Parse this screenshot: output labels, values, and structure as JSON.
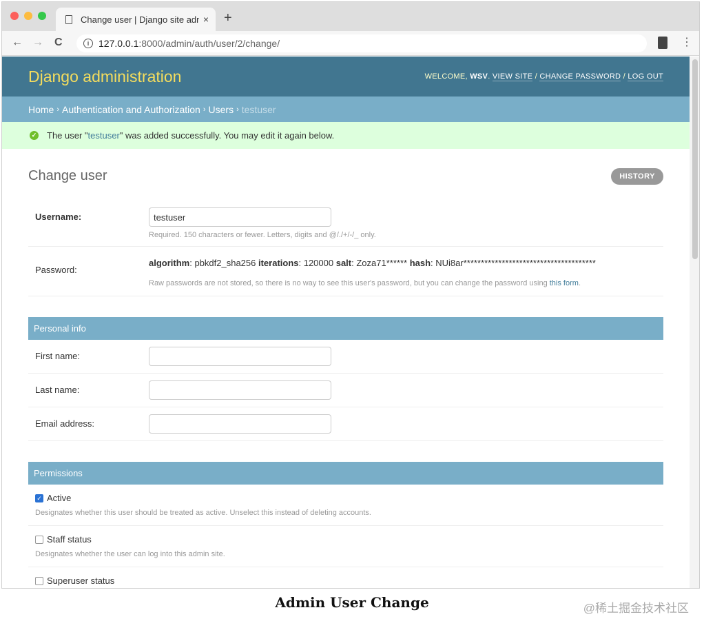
{
  "browser": {
    "tab_title": "Change user | Django site adm",
    "tab_close": "×",
    "new_tab": "+",
    "url_host": "127.0.0.1",
    "url_path": ":8000/admin/auth/user/2/change/",
    "back": "←",
    "forward": "→",
    "reload": "C",
    "menu": "⋮",
    "info": "i"
  },
  "header": {
    "branding": "Django administration",
    "welcome": "WELCOME, ",
    "username": "WSV",
    "view_site": "VIEW SITE",
    "change_password": "CHANGE PASSWORD",
    "log_out": "LOG OUT",
    "sep": " / "
  },
  "breadcrumbs": {
    "home": "Home",
    "app": "Authentication and Authorization",
    "model": "Users",
    "current": "testuser",
    "sep": "›"
  },
  "message": {
    "pre": "The user \"",
    "link": "testuser",
    "post": "\" was added successfully. You may edit it again below."
  },
  "page": {
    "title": "Change user",
    "history": "HISTORY"
  },
  "form": {
    "username": {
      "label": "Username:",
      "value": "testuser",
      "help": "Required. 150 characters or fewer. Letters, digits and @/./+/-/_ only."
    },
    "password": {
      "label": "Password:",
      "algorithm_key": "algorithm",
      "algorithm_val": ": pbkdf2_sha256 ",
      "iterations_key": "iterations",
      "iterations_val": ": 120000 ",
      "salt_key": "salt",
      "salt_val": ": Zoza71****** ",
      "hash_key": "hash",
      "hash_val": ": NUi8ar**************************************",
      "help_pre": "Raw passwords are not stored, so there is no way to see this user's password, but you can change the password using ",
      "help_link": "this form",
      "help_post": "."
    }
  },
  "personal_info": {
    "title": "Personal info",
    "first_name": {
      "label": "First name:",
      "value": ""
    },
    "last_name": {
      "label": "Last name:",
      "value": ""
    },
    "email": {
      "label": "Email address:",
      "value": ""
    }
  },
  "permissions": {
    "title": "Permissions",
    "active": {
      "label": "Active",
      "checked": true,
      "help": "Designates whether this user should be treated as active. Unselect this instead of deleting accounts."
    },
    "staff": {
      "label": "Staff status",
      "checked": false,
      "help": "Designates whether the user can log into this admin site."
    },
    "superuser": {
      "label": "Superuser status",
      "checked": false
    }
  },
  "caption": "Admin User Change",
  "watermark": "@稀土掘金技术社区",
  "colors": {
    "header_bg": "#417690",
    "branding": "#f5dd5d",
    "breadcrumb_bg": "#79aec8",
    "message_bg": "#ddffdd",
    "success": "#70bf2b",
    "link": "#447e9b"
  }
}
